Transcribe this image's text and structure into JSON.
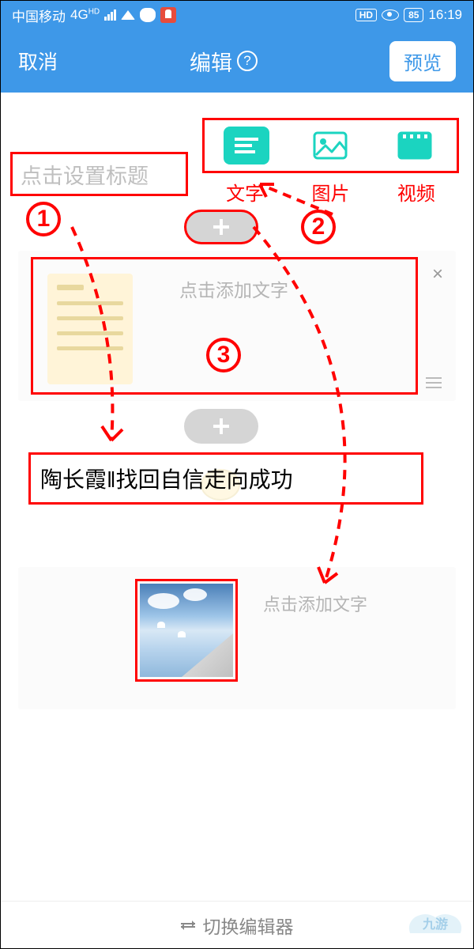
{
  "status": {
    "carrier": "中国移动",
    "net": "4G",
    "hd": "HD",
    "battery": "85",
    "time": "16:19"
  },
  "appbar": {
    "cancel": "取消",
    "title": "编辑",
    "preview": "预览"
  },
  "title_input": {
    "placeholder": "点击设置标题"
  },
  "toolbar": {
    "text": "文字",
    "image": "图片",
    "video": "视频"
  },
  "badges": {
    "one": "1",
    "two": "2",
    "three": "3"
  },
  "section": {
    "hint": "点击添加文字",
    "close": "×"
  },
  "headline": {
    "text": "陶长霞‖找回自信走向成功"
  },
  "section2": {
    "hint": "点击添加文字"
  },
  "bottom": {
    "switch": "切换编辑器"
  },
  "watermark": {
    "text": "九游"
  },
  "colors": {
    "primary": "#3e98e8",
    "accent": "#1bd4c0",
    "annot": "#ff0000"
  }
}
